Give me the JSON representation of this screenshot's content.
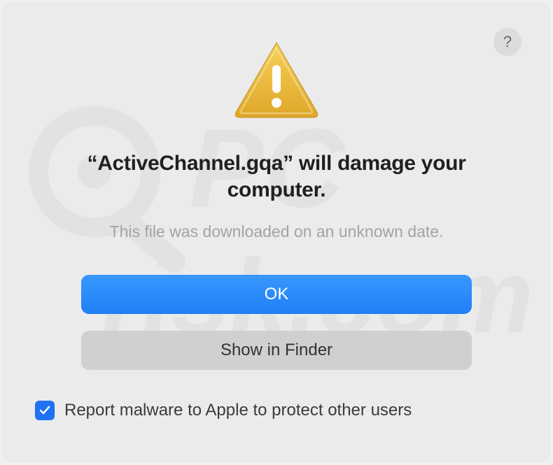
{
  "dialog": {
    "title_prefix": "“",
    "title_filename": "ActiveChannel.gqa",
    "title_suffix": "” will damage your computer.",
    "subtitle": "This file was downloaded on an unknown date.",
    "help_label": "?",
    "primary_button": "OK",
    "secondary_button": "Show in Finder",
    "checkbox_label": "Report malware to Apple to protect other users",
    "checkbox_checked": true
  },
  "watermark_text": "pcrisk.com"
}
